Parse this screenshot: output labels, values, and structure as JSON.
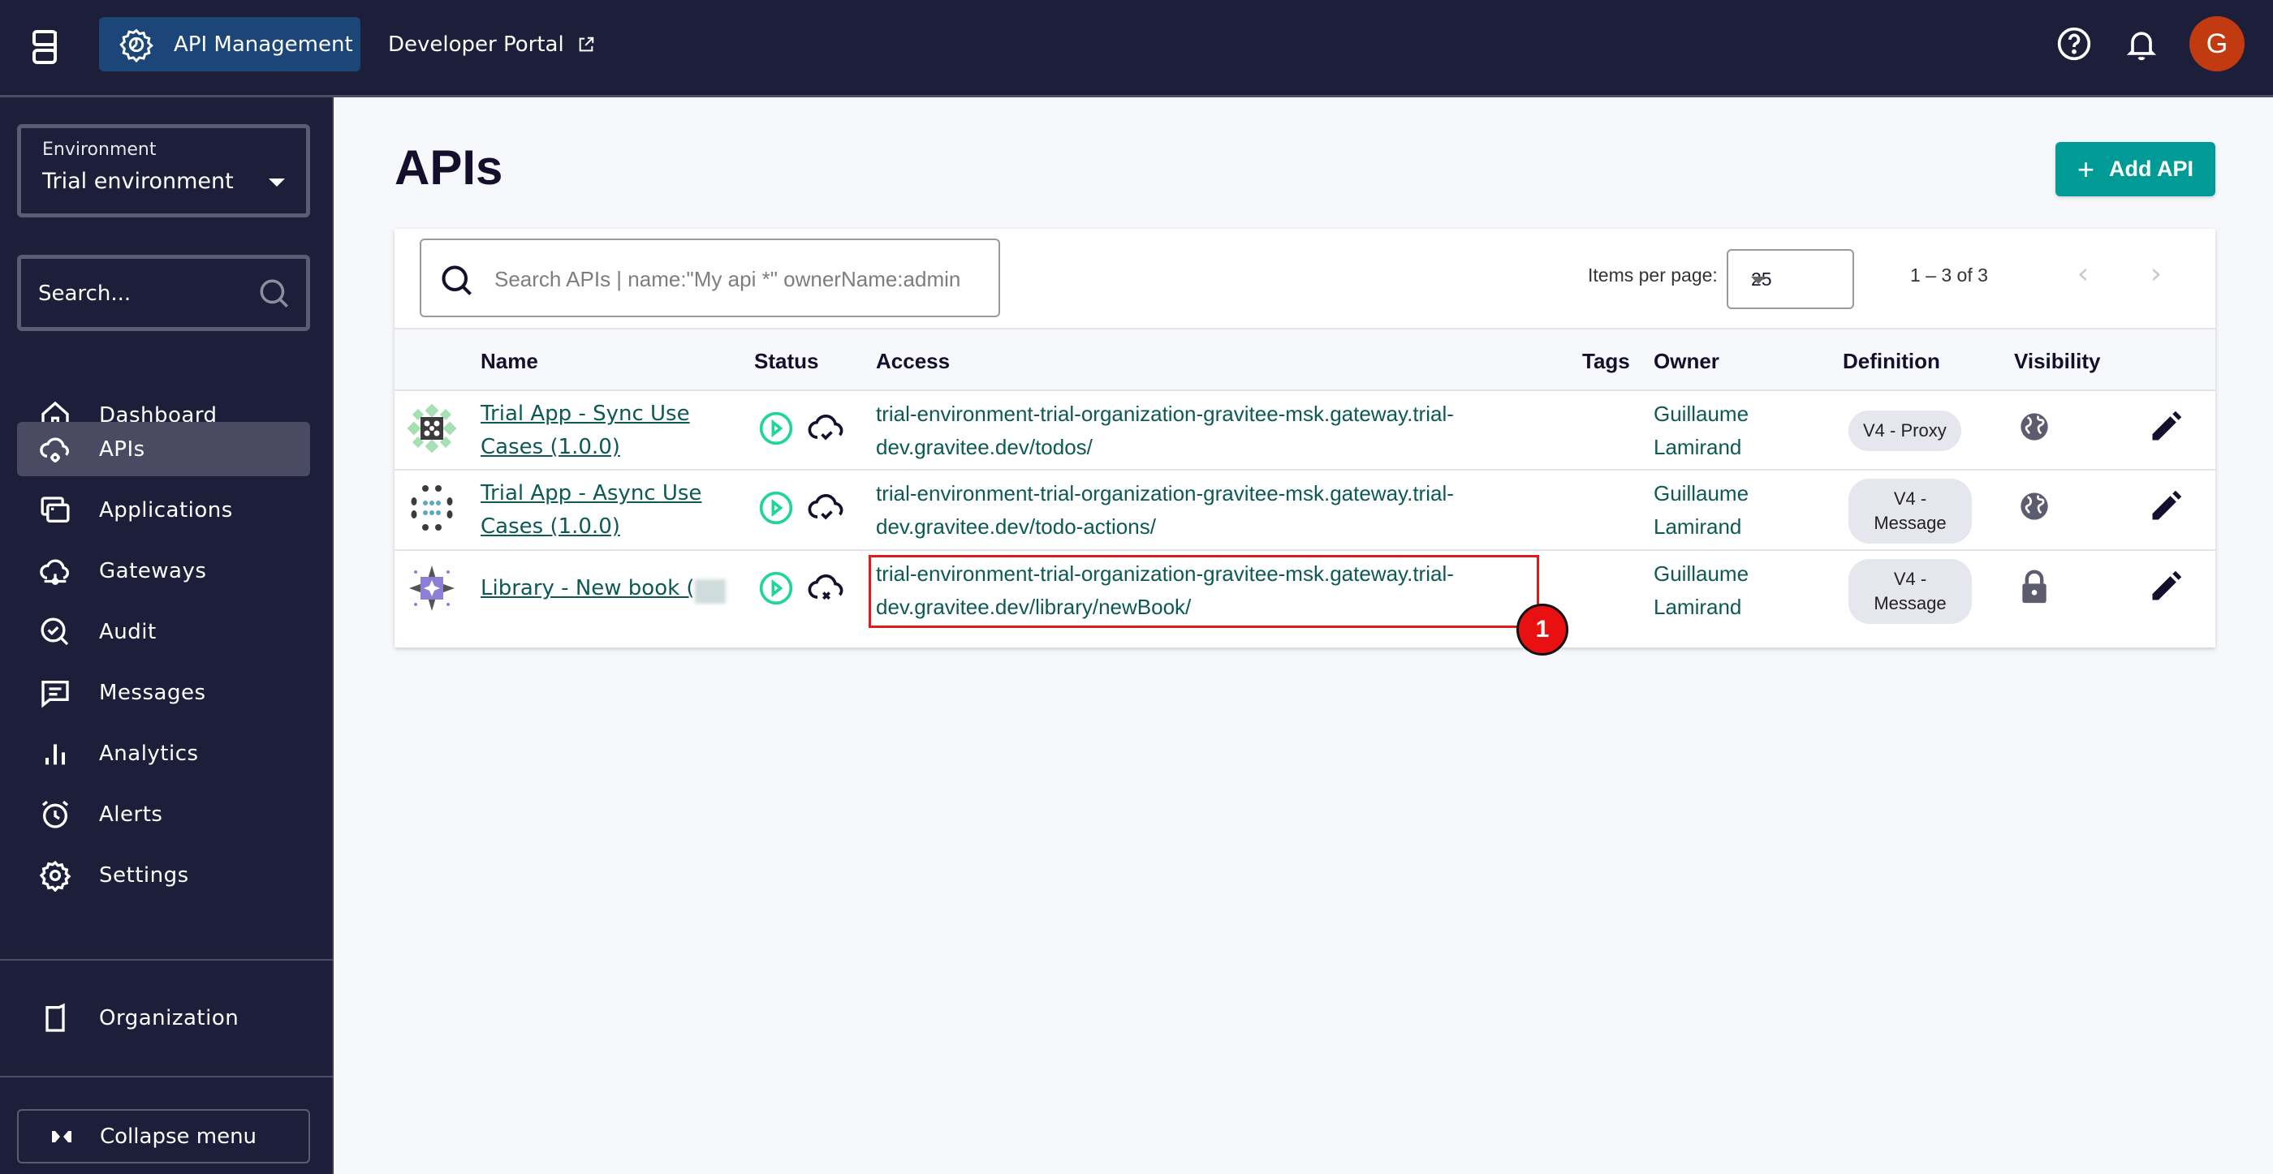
{
  "topbar": {
    "nav_active": "API Management",
    "nav_portal": "Developer Portal",
    "avatar_initial": "G",
    "icons": {
      "logo": "gravitee-logo-icon",
      "nav_active": "gear-icon",
      "nav_portal": "external-link-icon",
      "help": "help-circle-icon",
      "notifications": "bell-icon"
    }
  },
  "sidebar": {
    "environment_label": "Environment",
    "environment_value": "Trial environment",
    "search_placeholder": "Search...",
    "items": [
      {
        "label": "Dashboard",
        "icon": "home-icon",
        "active": false
      },
      {
        "label": "APIs",
        "icon": "cloud-gear-icon",
        "active": true
      },
      {
        "label": "Applications",
        "icon": "windows-icon",
        "active": false
      },
      {
        "label": "Gateways",
        "icon": "cloud-network-icon",
        "active": false
      },
      {
        "label": "Audit",
        "icon": "search-check-icon",
        "active": false
      },
      {
        "label": "Messages",
        "icon": "message-icon",
        "active": false
      },
      {
        "label": "Analytics",
        "icon": "bar-chart-icon",
        "active": false
      },
      {
        "label": "Alerts",
        "icon": "alarm-clock-icon",
        "active": false
      },
      {
        "label": "Settings",
        "icon": "gear-icon",
        "active": false
      }
    ],
    "organization": "Organization",
    "collapse": "Collapse menu"
  },
  "main": {
    "title": "APIs",
    "add_button": "Add API",
    "search_placeholder": "Search APIs | name:\"My api *\" ownerName:admin",
    "items_per_page_label": "Items per page:",
    "items_per_page_value": "25",
    "range": "1 – 3 of 3",
    "columns": [
      "Name",
      "Status",
      "Access",
      "Tags",
      "Owner",
      "Definition",
      "Visibility"
    ],
    "rows": [
      {
        "name": "Trial App - Sync Use Cases (1.0.0)",
        "status_state": "started",
        "deploy_state": "deployed",
        "access": "trial-environment-trial-organization-gravitee-msk.gateway.trial-dev.gravitee.dev/todos/",
        "tags": "",
        "owner": "Guillaume Lamirand",
        "definition": "V4 - Proxy",
        "visibility": "public",
        "visibility_icon": "globe-icon"
      },
      {
        "name": "Trial App - Async Use Cases (1.0.0)",
        "status_state": "started",
        "deploy_state": "deployed",
        "access": "trial-environment-trial-organization-gravitee-msk.gateway.trial-dev.gravitee.dev/todo-actions/",
        "tags": "",
        "owner": "Guillaume Lamirand",
        "definition": "V4 - Message",
        "visibility": "public",
        "visibility_icon": "globe-icon"
      },
      {
        "name": "Library - New book (",
        "name_blurred": true,
        "status_state": "started",
        "deploy_state": "not-synced",
        "access": "trial-environment-trial-organization-gravitee-msk.gateway.trial-dev.gravitee.dev/library/newBook/",
        "tags": "",
        "owner": "Guillaume Lamirand",
        "definition": "V4 - Message",
        "visibility": "private",
        "visibility_icon": "lock-icon"
      }
    ]
  },
  "annotation": {
    "marker_label": "1",
    "color": "#e11b1b"
  },
  "colors": {
    "topbar_bg": "#1d1e3a",
    "nav_active_bg": "#1b4677",
    "accent": "#009b96",
    "link": "#0d5955",
    "status_green": "#1fd59a",
    "avatar_bg": "#c23a10"
  }
}
